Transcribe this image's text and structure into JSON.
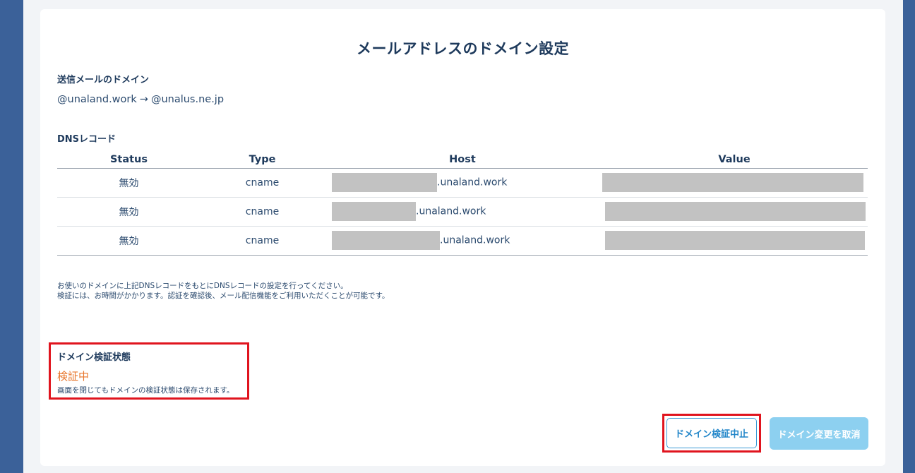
{
  "page": {
    "title": "メールアドレスのドメイン設定"
  },
  "sender_domain": {
    "label": "送信メールのドメイン",
    "from": "@unaland.work",
    "arrow": "→",
    "to": "@unalus.ne.jp"
  },
  "dns": {
    "label": "DNSレコード",
    "columns": [
      "Status",
      "Type",
      "Host",
      "Value"
    ],
    "rows": [
      {
        "status": "無効",
        "type": "cname",
        "host_suffix": ".unaland.work"
      },
      {
        "status": "無効",
        "type": "cname",
        "host_suffix": ".unaland.work"
      },
      {
        "status": "無効",
        "type": "cname",
        "host_suffix": ".unaland.work"
      }
    ]
  },
  "notes": {
    "line1": "お使いのドメインに上記DNSレコードをもとにDNSレコードの設定を行ってください。",
    "line2": "検証には、お時間がかかります。認証を確認後、メール配信機能をご利用いただくことが可能です。"
  },
  "verification": {
    "label": "ドメイン検証状態",
    "status": "検証中",
    "status_color": "#e8772e",
    "note": "画面を閉じてもドメインの検証状態は保存されます。"
  },
  "buttons": {
    "stop_label": "ドメイン検証中止",
    "cancel_label": "ドメイン変更を取消"
  },
  "colors": {
    "sidebar": "#3b6199",
    "highlight_border": "#e0141e",
    "primary": "#2286c9",
    "disabled_button": "#8dd0f0"
  }
}
